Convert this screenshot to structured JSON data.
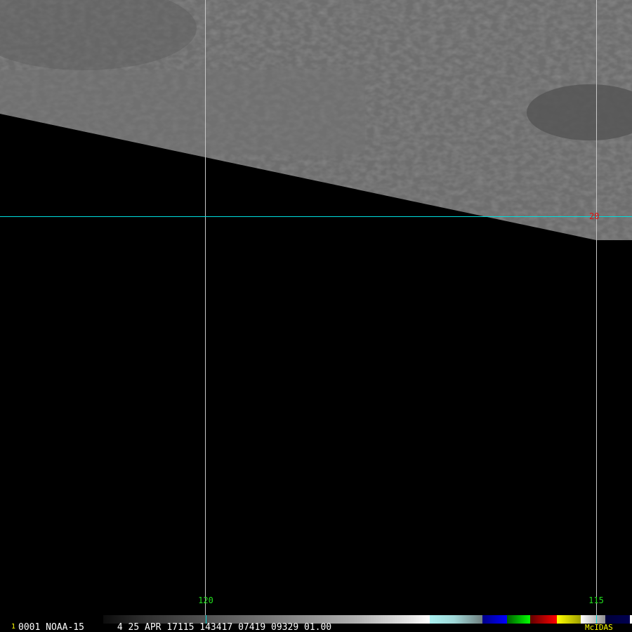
{
  "image": {
    "satellite": "NOAA-15",
    "frame_number": "1",
    "info_line": "0001 NOAA-15      4 25 APR 17115 143417 07419 09329 01.00",
    "software_label": "McIDAS"
  },
  "grid": {
    "longitude_labels": [
      "120",
      "115"
    ],
    "latitude_labels": [
      "20"
    ]
  },
  "colors": {
    "grid_vertical": "#c8c8c8",
    "grid_horizontal": "#00e0e0",
    "lon_label": "#22e01e",
    "lat_label": "#e01010",
    "software_label": "#ffff00",
    "imagery_gray": "#6a6a6a"
  }
}
